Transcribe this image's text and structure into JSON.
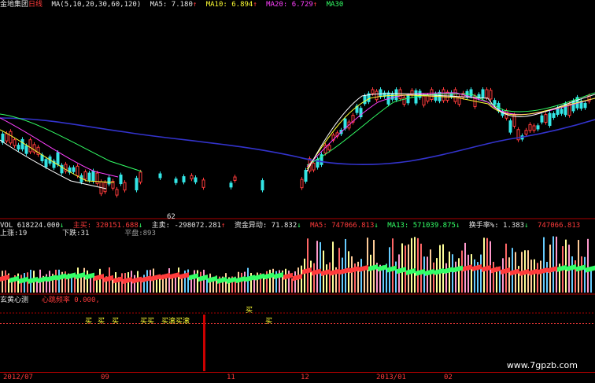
{
  "title_bar": {
    "stock_name": "金地集团",
    "period": "日线",
    "ma_spec": "MA(5,10,20,30,60,120)",
    "ma5_label": "MA5:",
    "ma5_value": "7.180",
    "ma10_label": "MA10:",
    "ma10_value": "6.894",
    "ma20_label": "MA20:",
    "ma20_value": "6.729",
    "ma30_label": "MA30"
  },
  "price_low_label": "62",
  "vol_bar": {
    "vol_label": "VOL",
    "vol_value": "618224.000",
    "main_buy_label": "主买:",
    "main_buy_value": "320151.688",
    "main_sell_label": "主卖:",
    "main_sell_value": "-298072.281",
    "fund_label": "资金异动:",
    "fund_value": "71.832",
    "ma5_label": "MA5:",
    "ma5_value": "747066.813",
    "ma13_label": "MA13:",
    "ma13_value": "571039.875",
    "turnover_label": "换手率%:",
    "turnover_value": "1.383",
    "extra_value": "747066.813"
  },
  "vol_sub": {
    "up_label": "上涨:",
    "up_value": "19",
    "down_label": "下跌:",
    "down_value": "31",
    "flat_label": "平盘:",
    "flat_value": "893"
  },
  "indicator": {
    "name": "玄黄心测",
    "param_label": "心跳频率",
    "param_value": "0.000,"
  },
  "signals": {
    "buy": "买",
    "cluster": "买买",
    "seq": "买滚买滚"
  },
  "axis_labels": [
    "2012/07",
    "09",
    "11",
    "12",
    "2013/01",
    "02"
  ],
  "watermark": "www.7gpzb.com",
  "colors": {
    "up": "#ff3b3b",
    "down": "#33ff66",
    "ma5": "#ffffff",
    "ma10": "#ffff33",
    "ma20": "#ff40ff",
    "ma30": "#33ff66",
    "ma60": "#3333cc"
  }
}
